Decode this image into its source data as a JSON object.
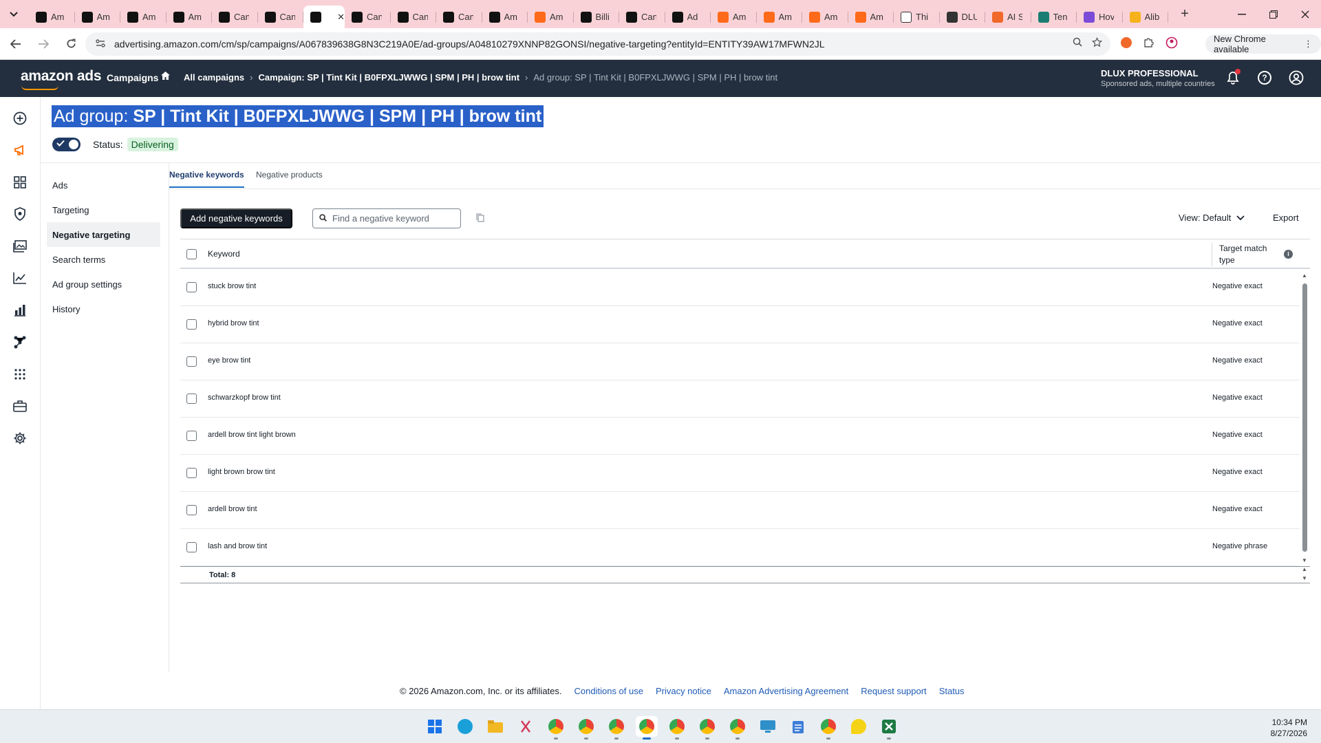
{
  "browser": {
    "tabs": [
      {
        "label": "Am",
        "icon": "amazon-favicon",
        "color": "#111111"
      },
      {
        "label": "Am",
        "icon": "amazon-favicon",
        "color": "#111111"
      },
      {
        "label": "Am",
        "icon": "amazon-favicon",
        "color": "#111111"
      },
      {
        "label": "Am",
        "icon": "amazon-favicon",
        "color": "#111111"
      },
      {
        "label": "Can",
        "icon": "email-favicon",
        "color": "#111111"
      },
      {
        "label": "Can",
        "icon": "email-favicon",
        "color": "#111111"
      },
      {
        "label": "",
        "icon": "email-favicon",
        "color": "#111111",
        "active": true
      },
      {
        "label": "Can",
        "icon": "email-favicon",
        "color": "#111111"
      },
      {
        "label": "Can",
        "icon": "email-favicon",
        "color": "#111111"
      },
      {
        "label": "Can",
        "icon": "email-favicon",
        "color": "#111111"
      },
      {
        "label": "Am",
        "icon": "amazon-favicon",
        "color": "#111111"
      },
      {
        "label": "Am",
        "icon": "amazon-seller-favicon",
        "color": "#ff6a1a"
      },
      {
        "label": "Billi",
        "icon": "billing-favicon",
        "color": "#111111"
      },
      {
        "label": "Can",
        "icon": "email-favicon",
        "color": "#111111"
      },
      {
        "label": "Ad",
        "icon": "email-favicon",
        "color": "#111111"
      },
      {
        "label": "Am",
        "icon": "amazon-seller-favicon",
        "color": "#ff6a1a"
      },
      {
        "label": "Am",
        "icon": "amazon-seller-favicon",
        "color": "#ff6a1a"
      },
      {
        "label": "Am",
        "icon": "amazon-seller-favicon",
        "color": "#ff6a1a"
      },
      {
        "label": "Am",
        "icon": "amazon-seller-favicon",
        "color": "#ff6a1a"
      },
      {
        "label": "Thi",
        "icon": "openai-favicon",
        "color": "#ffffff"
      },
      {
        "label": "DLU",
        "icon": "dlux-favicon",
        "color": "#333333"
      },
      {
        "label": "AI S",
        "icon": "ai-favicon",
        "color": "#f0682a"
      },
      {
        "label": "Ten",
        "icon": "teal-favicon",
        "color": "#1a7f72"
      },
      {
        "label": "Hov",
        "icon": "quora-favicon",
        "color": "#7b4bd8"
      },
      {
        "label": "Alib",
        "icon": "alibaba-favicon",
        "color": "#f5b21a"
      }
    ],
    "close_tab_icon": "close-icon",
    "new_tab_icon": "plus-icon",
    "url": "advertising.amazon.com/cm/sp/campaigns/A067839638G8N3C219A0E/ad-groups/A04810279XNNP82GONSI/negative-targeting?entityId=ENTITY39AW17MFWN2JL",
    "new_chrome_label": "New Chrome available"
  },
  "header": {
    "logo_text": "amazon ads",
    "nav_campaigns": "Campaigns",
    "breadcrumbs": [
      "All campaigns",
      "Campaign: SP | Tint Kit | B0FPXLJWWG | SPM | PH | brow tint",
      "Ad group: SP | Tint Kit | B0FPXLJWWG | SPM | PH | brow tint"
    ],
    "account_name": "DLUX PROFESSIONAL",
    "account_sub": "Sponsored ads, multiple countries"
  },
  "page": {
    "title_label": "Ad group:",
    "title_value": "SP | Tint Kit | B0FPXLJWWG | SPM | PH | brow tint",
    "status_label": "Status:",
    "status_value": "Delivering",
    "toggle_on": true
  },
  "subnav": [
    {
      "label": "Ads"
    },
    {
      "label": "Targeting"
    },
    {
      "label": "Negative targeting",
      "active": true
    },
    {
      "label": "Search terms"
    },
    {
      "label": "Ad group settings"
    },
    {
      "label": "History"
    }
  ],
  "tabs": {
    "negative_keywords": "Negative keywords",
    "negative_products": "Negative products"
  },
  "actions": {
    "add_label": "Add negative keywords",
    "search_placeholder": "Find a negative keyword",
    "view_label": "View: Default",
    "export_label": "Export"
  },
  "table": {
    "col_keyword": "Keyword",
    "col_match": "Target match type",
    "rows": [
      {
        "keyword": "stuck brow tint",
        "match": "Negative exact"
      },
      {
        "keyword": "hybrid brow tint",
        "match": "Negative exact"
      },
      {
        "keyword": "eye brow tint",
        "match": "Negative exact"
      },
      {
        "keyword": "schwarzkopf brow tint",
        "match": "Negative exact"
      },
      {
        "keyword": "ardell brow tint light brown",
        "match": "Negative exact"
      },
      {
        "keyword": "light brown brow tint",
        "match": "Negative exact"
      },
      {
        "keyword": "ardell brow tint",
        "match": "Negative exact"
      },
      {
        "keyword": "lash and brow tint",
        "match": "Negative phrase"
      }
    ],
    "total": "Total: 8"
  },
  "footer": {
    "copyright": "© 2026 Amazon.com, Inc. or its affiliates.",
    "links": [
      "Conditions of use",
      "Privacy notice",
      "Amazon Advertising Agreement",
      "Request support",
      "Status"
    ]
  },
  "taskbar": {
    "time": "10:34 PM",
    "date": "8/27/2026"
  },
  "colors": {
    "ads_header": "#232f3e",
    "title_highlight": "#2a61c9",
    "status_badge_bg": "#d8f3df",
    "primary_button": "#161d26",
    "link": "#1f5bb5",
    "tabstrip": "#f9d2d7"
  }
}
